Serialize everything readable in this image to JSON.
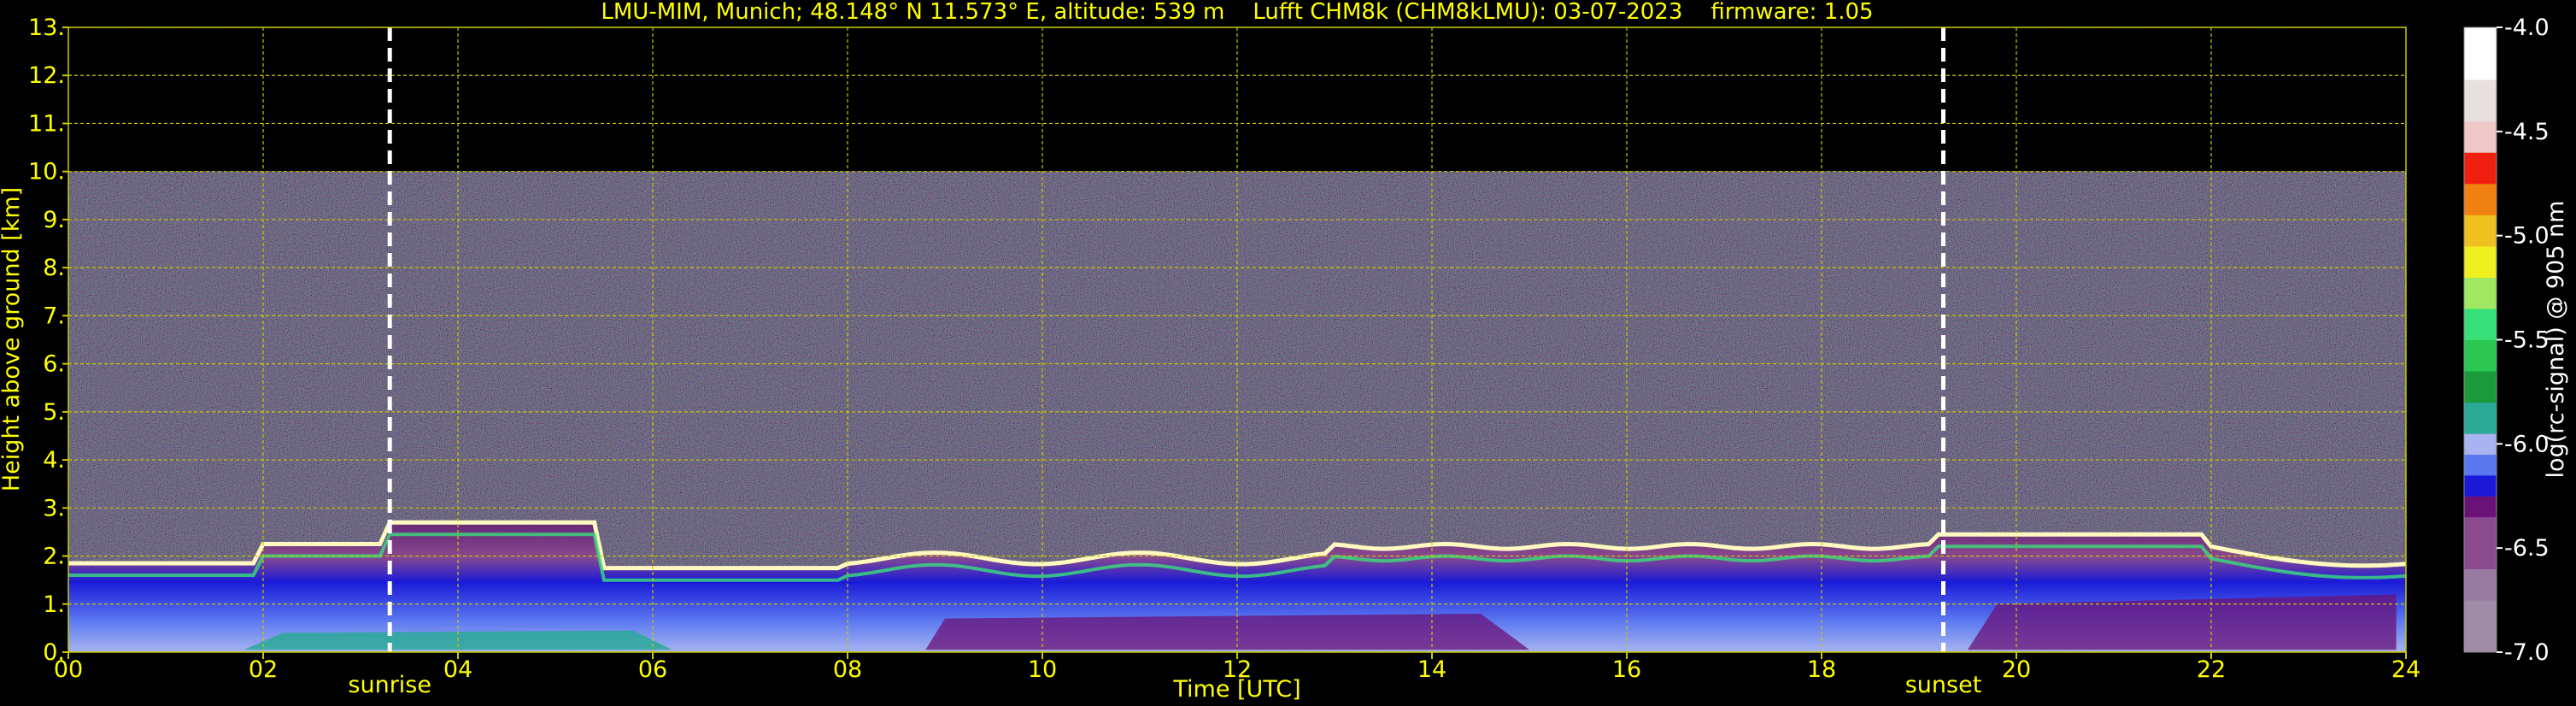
{
  "chart_data": {
    "type": "heatmap",
    "title": "LMU-MIM, Munich; 48.148° N 11.573° E, altitude: 539 m    Lufft CHM8k (CHM8kLMU): 03-07-2023    firmware: 1.05",
    "xlabel": "Time [UTC]",
    "ylabel": "Height above ground [km]",
    "xlim": [
      0,
      24
    ],
    "ylim": [
      0,
      13
    ],
    "x_ticks": [
      "00",
      "02",
      "04",
      "06",
      "08",
      "10",
      "12",
      "14",
      "16",
      "18",
      "20",
      "22",
      "24"
    ],
    "x_tick_values": [
      0,
      2,
      4,
      6,
      8,
      10,
      12,
      14,
      16,
      18,
      20,
      22,
      24
    ],
    "y_ticks": [
      "0.",
      "1.",
      "2.",
      "3.",
      "4.",
      "5.",
      "6.",
      "7.",
      "8.",
      "9.",
      "10.",
      "11.",
      "12.",
      "13."
    ],
    "y_tick_values": [
      0,
      1,
      2,
      3,
      4,
      5,
      6,
      7,
      8,
      9,
      10,
      11,
      12,
      13
    ],
    "grid": true,
    "measurement_top_km": 10,
    "events": [
      {
        "label": "sunrise",
        "time": 3.3
      },
      {
        "label": "sunset",
        "time": 19.25
      }
    ],
    "colorbar": {
      "label": "log(rc-signal) @ 905 nm",
      "range": [
        -7.0,
        -4.0
      ],
      "ticks": [
        "-4.0",
        "-4.5",
        "-5.0",
        "-5.5",
        "-6.0",
        "-6.5",
        "-7.0"
      ],
      "tick_values": [
        -4.0,
        -4.5,
        -5.0,
        -5.5,
        -6.0,
        -6.5,
        -7.0
      ],
      "stops": [
        {
          "value": -7.0,
          "color": "#a08ca8"
        },
        {
          "value": -6.75,
          "color": "#9a7aa2"
        },
        {
          "value": -6.6,
          "color": "#8a4a8e"
        },
        {
          "value": -6.35,
          "color": "#6a1278"
        },
        {
          "value": -6.25,
          "color": "#1a1ad8"
        },
        {
          "value": -6.15,
          "color": "#5a78f0"
        },
        {
          "value": -6.05,
          "color": "#a8b4f0"
        },
        {
          "value": -5.95,
          "color": "#2aa898"
        },
        {
          "value": -5.8,
          "color": "#1a9a3a"
        },
        {
          "value": -5.65,
          "color": "#2ac850"
        },
        {
          "value": -5.5,
          "color": "#38e07a"
        },
        {
          "value": -5.35,
          "color": "#a0e860"
        },
        {
          "value": -5.2,
          "color": "#f0f020"
        },
        {
          "value": -5.05,
          "color": "#f0c020"
        },
        {
          "value": -4.9,
          "color": "#f08010"
        },
        {
          "value": -4.75,
          "color": "#f02010"
        },
        {
          "value": -4.6,
          "color": "#f0c8c8"
        },
        {
          "value": -4.45,
          "color": "#e8e0e0"
        },
        {
          "value": -4.25,
          "color": "#ffffff"
        }
      ]
    },
    "colors": {
      "text": "#ffff00",
      "grid": "#c8c800",
      "background": "#000000",
      "event_line": "#ffffff"
    }
  }
}
